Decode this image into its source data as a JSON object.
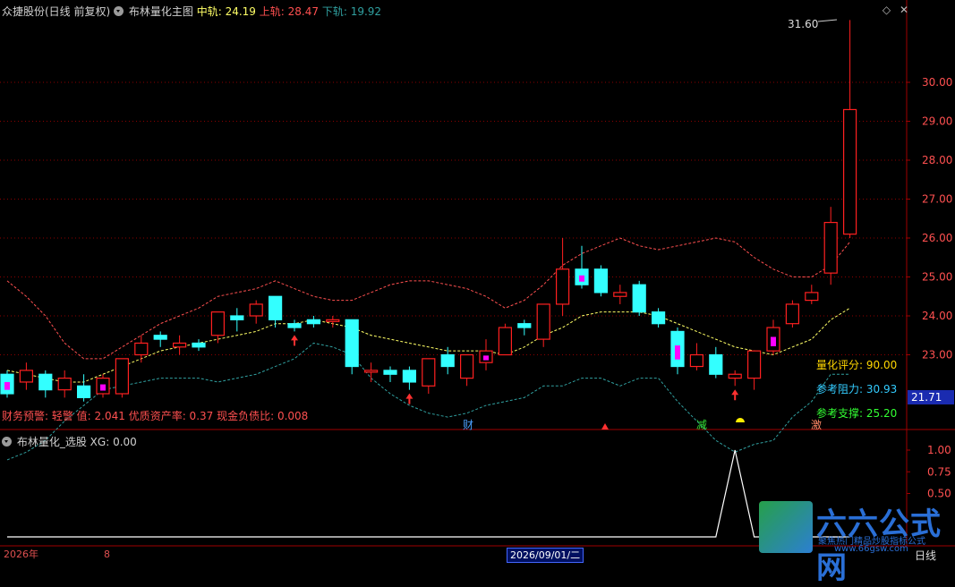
{
  "main_panel": {
    "title": "众捷股份(日线 前复权)",
    "indicator_name": "布林量化主图",
    "mid_label": "中轨:",
    "mid_value": "24.19",
    "upper_label": "上轨:",
    "upper_value": "28.47",
    "lower_label": "下轨:",
    "lower_value": "19.92",
    "high_annotation": "31.60",
    "current_price_tag": "21.71",
    "finance_warning": "财务预警: 轻警   值: 2.041 优质资产率: 0.37 现金负债比: 0.008",
    "info": {
      "score_label": "量化评分:",
      "score_value": "90.00",
      "resistance_label": "参考阻力:",
      "resistance_value": "30.93",
      "support_label": "参考支撑:",
      "support_value": "25.20"
    },
    "markers": {
      "cai": "财",
      "jian": "减",
      "ji": "激"
    }
  },
  "sub_panel": {
    "indicator_name": "布林量化_选股",
    "xg_label": "XG:",
    "xg_value": "0.00"
  },
  "footer": {
    "year_label": "2026年",
    "month_label": "8",
    "cursor_date": "2026/09/01/二",
    "period_label": "日线"
  },
  "watermark": {
    "big_text": "六六公式网",
    "small_text": "聚焦热门精品炒股指标公式",
    "url": "www.66gsw.com"
  },
  "colors": {
    "background": "#000000",
    "up": "#ff2020",
    "down": "#33ffff",
    "mid_band": "#ffff66",
    "upper_band": "#ff5050",
    "lower_band": "#30a0a0",
    "grid": "#8b0000",
    "axis_text": "#ff5050",
    "score_label": "#ffd700",
    "resistance_color": "#33ccff",
    "support_color": "#33ff33"
  },
  "chart_data": {
    "type": "candlestick",
    "y_axis_main": {
      "ticks": [
        23.0,
        24.0,
        25.0,
        26.0,
        27.0,
        28.0,
        29.0,
        30.0
      ],
      "labels": [
        "23.00",
        "24.00",
        "25.00",
        "26.00",
        "27.00",
        "28.00",
        "29.00",
        "30.00"
      ]
    },
    "y_axis_sub": {
      "ticks": [
        0.5,
        0.75,
        1.0
      ],
      "labels": [
        "0.50",
        "0.75",
        "1.00"
      ]
    },
    "candles": [
      [
        22.5,
        22.0,
        22.6,
        21.9
      ],
      [
        22.3,
        22.6,
        22.8,
        22.1
      ],
      [
        22.5,
        22.1,
        22.6,
        21.9
      ],
      [
        22.1,
        22.4,
        22.6,
        21.9
      ],
      [
        22.2,
        21.9,
        22.5,
        21.8
      ],
      [
        22.0,
        22.4,
        22.5,
        21.9
      ],
      [
        22.0,
        22.9,
        22.9,
        21.9
      ],
      [
        23.0,
        23.3,
        23.5,
        22.8
      ],
      [
        23.5,
        23.4,
        23.6,
        23.2
      ],
      [
        23.2,
        23.3,
        23.5,
        23.0
      ],
      [
        23.3,
        23.2,
        23.4,
        23.1
      ],
      [
        23.5,
        24.1,
        24.1,
        23.3
      ],
      [
        24.0,
        23.9,
        24.2,
        23.6
      ],
      [
        24.0,
        24.3,
        24.4,
        23.8
      ],
      [
        24.5,
        23.9,
        24.5,
        23.7
      ],
      [
        23.8,
        23.7,
        23.9,
        23.6
      ],
      [
        23.9,
        23.8,
        24.0,
        23.7
      ],
      [
        23.9,
        23.9,
        24.0,
        23.7
      ],
      [
        23.9,
        22.7,
        23.9,
        22.5
      ],
      [
        22.6,
        22.6,
        22.8,
        22.3
      ],
      [
        22.6,
        22.5,
        22.7,
        22.3
      ],
      [
        22.6,
        22.3,
        22.7,
        22.1
      ],
      [
        22.2,
        22.9,
        22.9,
        22.0
      ],
      [
        23.0,
        22.7,
        23.2,
        22.5
      ],
      [
        22.4,
        23.0,
        23.0,
        22.2
      ],
      [
        22.8,
        23.1,
        23.4,
        22.6
      ],
      [
        23.0,
        23.7,
        23.8,
        23.0
      ],
      [
        23.8,
        23.7,
        23.9,
        23.5
      ],
      [
        23.4,
        24.3,
        24.3,
        23.2
      ],
      [
        24.3,
        25.2,
        26.0,
        24.0
      ],
      [
        25.2,
        24.8,
        25.8,
        24.7
      ],
      [
        25.2,
        24.6,
        25.3,
        24.5
      ],
      [
        24.5,
        24.6,
        24.8,
        24.3
      ],
      [
        24.8,
        24.1,
        24.9,
        24.0
      ],
      [
        24.1,
        23.8,
        24.2,
        23.7
      ],
      [
        23.6,
        22.7,
        23.7,
        22.5
      ],
      [
        22.7,
        23.0,
        23.3,
        22.6
      ],
      [
        23.0,
        22.5,
        23.2,
        22.4
      ],
      [
        22.4,
        22.5,
        22.6,
        22.2
      ],
      [
        22.4,
        23.1,
        23.1,
        22.1
      ],
      [
        23.1,
        23.7,
        23.9,
        23.0
      ],
      [
        23.8,
        24.3,
        24.4,
        23.7
      ],
      [
        24.4,
        24.6,
        24.8,
        24.3
      ],
      [
        25.1,
        26.4,
        26.8,
        24.8
      ],
      [
        26.1,
        29.3,
        31.6,
        26.0
      ]
    ],
    "upper_band": [
      24.9,
      24.5,
      24.0,
      23.3,
      22.9,
      22.9,
      23.2,
      23.5,
      23.8,
      24.0,
      24.2,
      24.5,
      24.6,
      24.7,
      24.9,
      24.7,
      24.5,
      24.4,
      24.4,
      24.6,
      24.8,
      24.9,
      24.9,
      24.8,
      24.7,
      24.5,
      24.2,
      24.4,
      24.8,
      25.3,
      25.6,
      25.8,
      26.0,
      25.8,
      25.7,
      25.8,
      25.9,
      26.0,
      25.9,
      25.5,
      25.2,
      25.0,
      25.0,
      25.3,
      25.9
    ],
    "mid_band": [
      22.6,
      22.5,
      22.4,
      22.3,
      22.3,
      22.5,
      22.7,
      22.9,
      23.1,
      23.2,
      23.3,
      23.4,
      23.5,
      23.6,
      23.8,
      23.8,
      23.9,
      23.8,
      23.7,
      23.5,
      23.4,
      23.3,
      23.2,
      23.1,
      23.1,
      23.1,
      23.0,
      23.2,
      23.5,
      23.7,
      24.0,
      24.1,
      24.1,
      24.1,
      24.0,
      23.8,
      23.6,
      23.4,
      23.2,
      23.1,
      23.0,
      23.2,
      23.4,
      23.9,
      24.2
    ],
    "lower_band": [
      20.3,
      20.5,
      20.8,
      21.3,
      21.7,
      22.1,
      22.2,
      22.3,
      22.4,
      22.4,
      22.4,
      22.3,
      22.4,
      22.5,
      22.7,
      22.9,
      23.3,
      23.2,
      23.0,
      22.4,
      22.0,
      21.7,
      21.5,
      21.4,
      21.5,
      21.7,
      21.8,
      21.9,
      22.2,
      22.2,
      22.4,
      22.4,
      22.2,
      22.4,
      22.4,
      21.8,
      21.3,
      20.8,
      20.5,
      20.7,
      20.8,
      21.4,
      21.8,
      22.5,
      22.5
    ],
    "xg_series": [
      0,
      0,
      0,
      0,
      0,
      0,
      0,
      0,
      0,
      0,
      0,
      0,
      0,
      0,
      0,
      0,
      0,
      0,
      0,
      0,
      0,
      0,
      0,
      0,
      0,
      0,
      0,
      0,
      0,
      0,
      0,
      0,
      0,
      0,
      0,
      0,
      0,
      0,
      1,
      0,
      0,
      0,
      0,
      0,
      0
    ]
  }
}
